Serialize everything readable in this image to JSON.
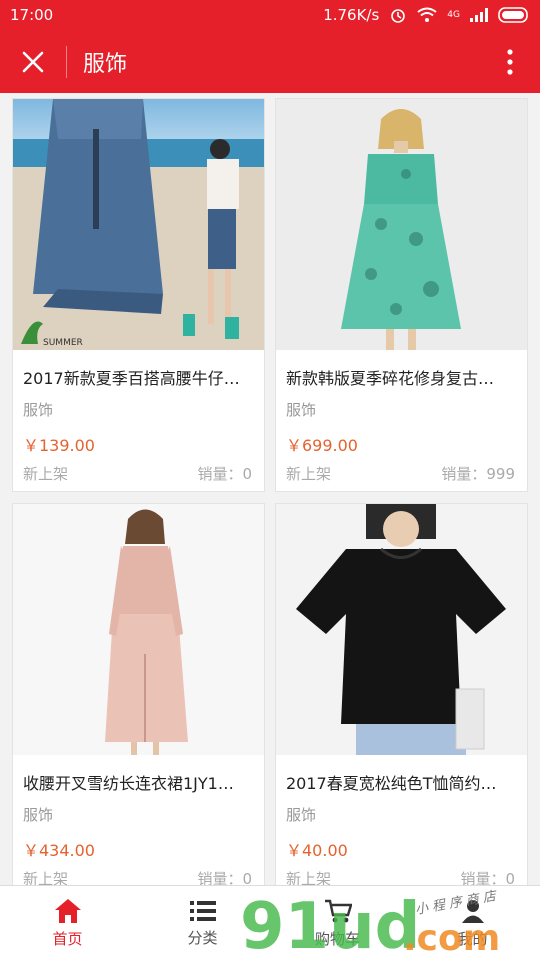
{
  "status": {
    "time": "17:00",
    "speed": "1.76K/s",
    "net": "4G"
  },
  "toolbar": {
    "title": "服饰"
  },
  "products": [
    {
      "name": "2017新款夏季百搭高腰牛仔…",
      "category": "服饰",
      "price": "￥139.00",
      "tag": "新上架",
      "sales": "销量：0"
    },
    {
      "name": "新款韩版夏季碎花修身复古…",
      "category": "服饰",
      "price": "￥699.00",
      "tag": "新上架",
      "sales": "销量：999"
    },
    {
      "name": "收腰开叉雪纺长连衣裙1JY1…",
      "category": "服饰",
      "price": "￥434.00",
      "tag": "新上架",
      "sales": "销量：0"
    },
    {
      "name": "2017春夏宽松纯色T恤简约…",
      "category": "服饰",
      "price": "￥40.00",
      "tag": "新上架",
      "sales": "销量：0"
    }
  ],
  "nav": [
    {
      "label": "首页",
      "icon": "home-icon"
    },
    {
      "label": "分类",
      "icon": "list-icon"
    },
    {
      "label": "购物车",
      "icon": "cart-icon"
    },
    {
      "label": "我的",
      "icon": "user-icon"
    }
  ],
  "watermark": {
    "text": "91ud",
    "domain": ".com",
    "subtitle": "小 程 序 商 店"
  },
  "colors": {
    "brand": "#e5202a",
    "price": "#e4632f"
  }
}
